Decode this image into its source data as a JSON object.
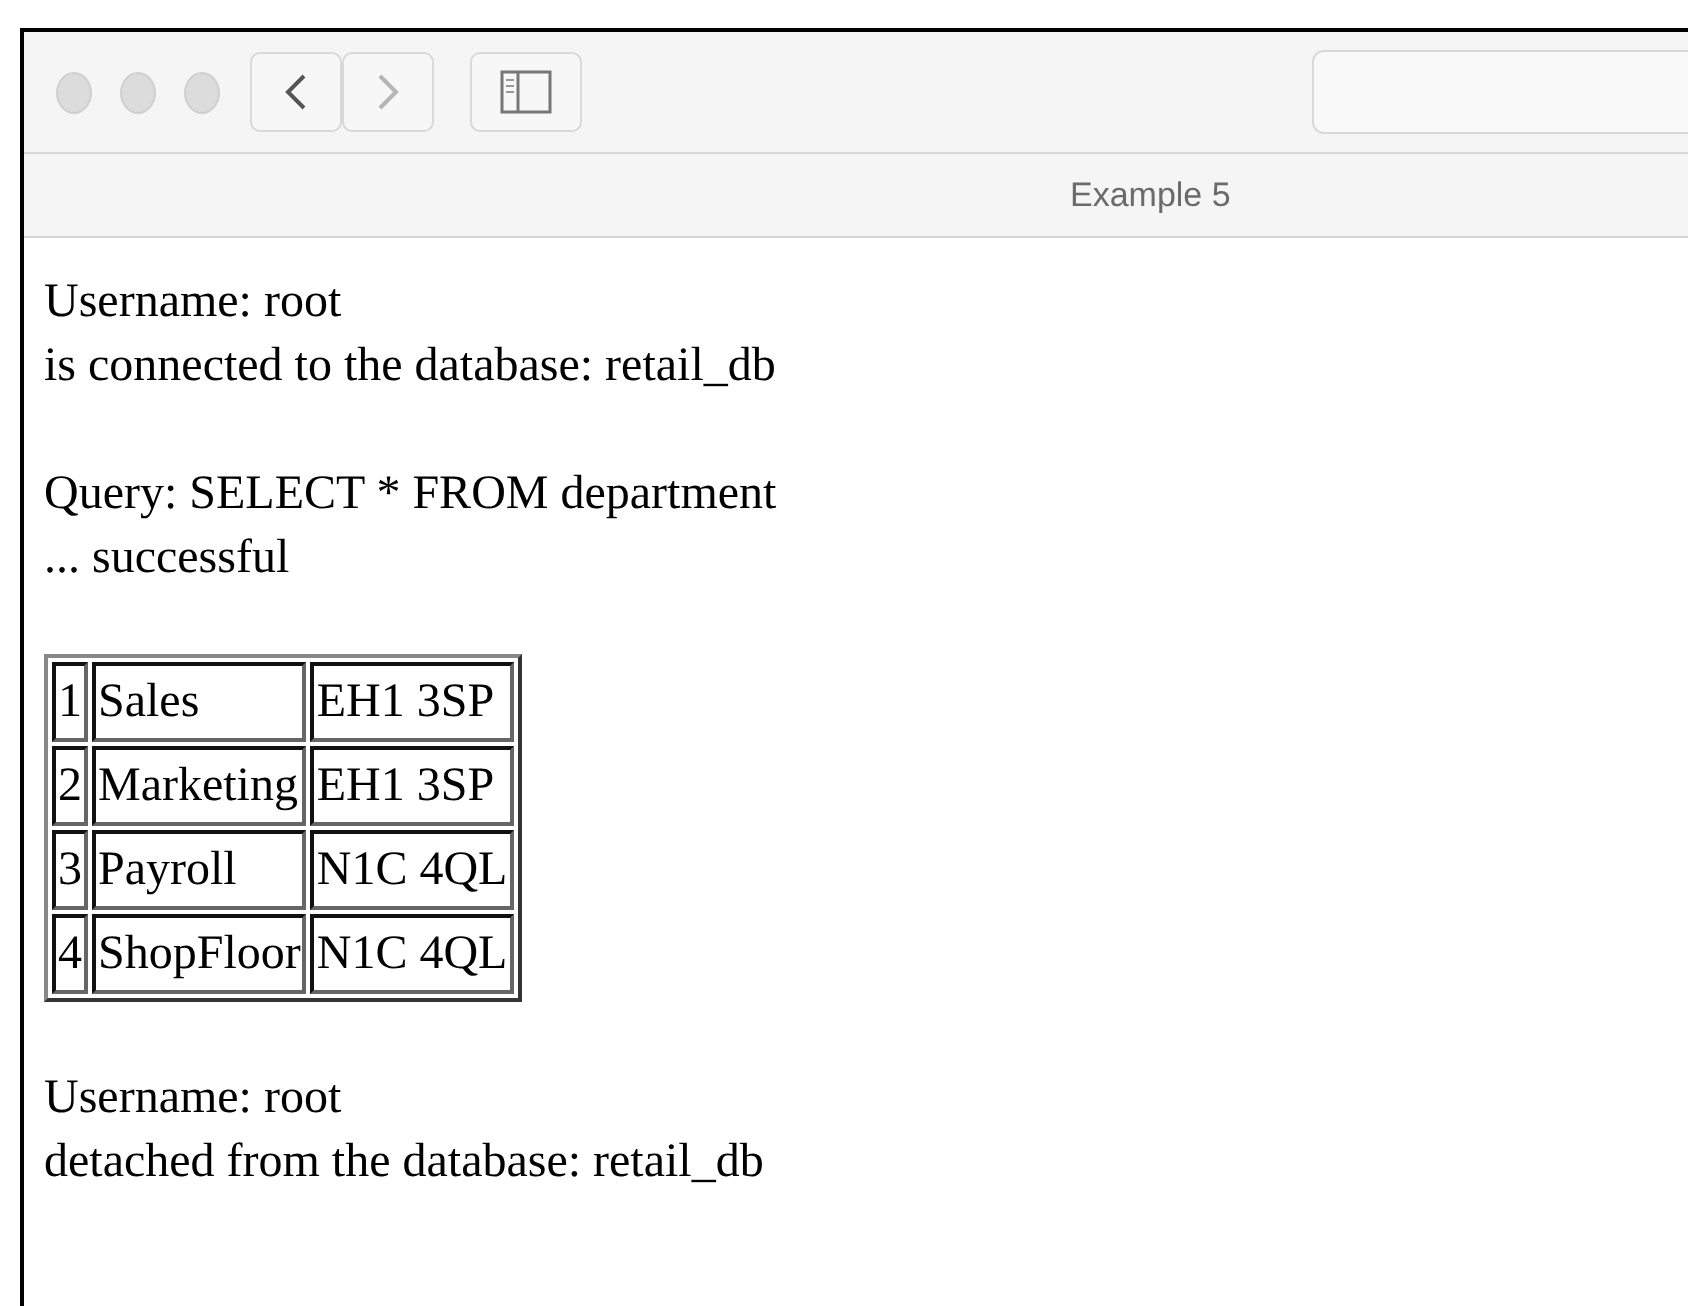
{
  "window": {
    "title": "Example 5"
  },
  "toolbar": {
    "nav_buttons": [
      {
        "kind": "back",
        "disabled": false
      },
      {
        "kind": "forward",
        "disabled": true
      }
    ]
  },
  "content": {
    "lines_before": [
      [
        "Username: root",
        "is connected to the database: retail_db"
      ],
      [
        "Query: SELECT * FROM department",
        "... successful"
      ]
    ],
    "table": {
      "rows": [
        [
          "1",
          "Sales",
          "EH1 3SP"
        ],
        [
          "2",
          "Marketing",
          "EH1 3SP"
        ],
        [
          "3",
          "Payroll",
          "N1C 4QL"
        ],
        [
          "4",
          "ShopFloor",
          "N1C 4QL"
        ]
      ]
    },
    "lines_after": [
      [
        "Username: root",
        "detached from the database: retail_db"
      ]
    ]
  }
}
